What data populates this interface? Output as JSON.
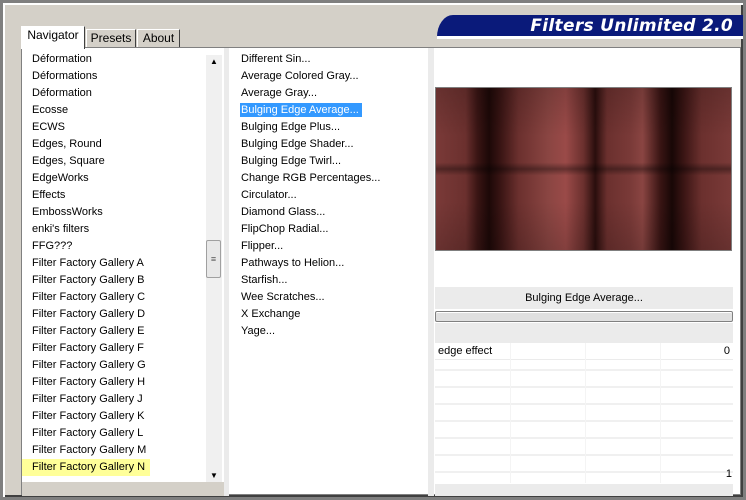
{
  "window": {
    "banner_title": "Filters Unlimited 2.0"
  },
  "tabs": [
    {
      "label": "Navigator",
      "active": true
    },
    {
      "label": "Presets",
      "active": false
    },
    {
      "label": "About",
      "active": false
    }
  ],
  "categories": [
    "Déformation",
    "Déformations",
    "Déformation",
    "Ecosse",
    "ECWS",
    "Edges, Round",
    "Edges, Square",
    "EdgeWorks",
    "Effects",
    "EmbossWorks",
    "enki's filters",
    "FFG???",
    "Filter Factory Gallery A",
    "Filter Factory Gallery B",
    "Filter Factory Gallery C",
    "Filter Factory Gallery D",
    "Filter Factory Gallery E",
    "Filter Factory Gallery F",
    "Filter Factory Gallery G",
    "Filter Factory Gallery H",
    "Filter Factory Gallery J",
    "Filter Factory Gallery K",
    "Filter Factory Gallery L",
    "Filter Factory Gallery M",
    "Filter Factory Gallery N"
  ],
  "selected_category": "Filter Factory Gallery N",
  "filters": [
    " Different Sin...",
    "Average Colored Gray...",
    "Average Gray...",
    "Bulging Edge Average...",
    "Bulging Edge Plus...",
    "Bulging Edge Shader...",
    "Bulging Edge Twirl...",
    "Change RGB Percentages...",
    "Circulator...",
    "Diamond Glass...",
    "FlipChop Radial...",
    "Flipper...",
    "Pathways to Helion...",
    "Starfish...",
    "Wee Scratches...",
    "X Exchange",
    "Yage..."
  ],
  "selected_filter": "Bulging Edge Average...",
  "current_filter_label": "Bulging Edge Average...",
  "parameters": [
    {
      "label": "edge effect",
      "value": "0"
    }
  ],
  "bottom_value": "1",
  "colors": {
    "banner_bg": "#0a1a7a",
    "selection_blue": "#3399ff",
    "category_highlight": "#ffff99",
    "dialog_gray": "#d4d0c8"
  }
}
